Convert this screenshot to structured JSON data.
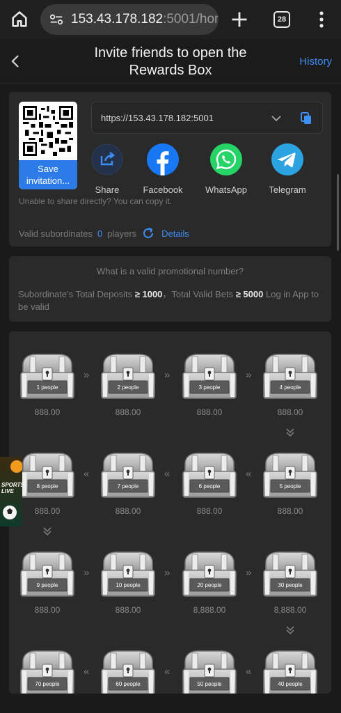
{
  "browser": {
    "url_host": "153.43.178.182",
    "url_rest": ":5001/hom",
    "tab_count": "28"
  },
  "header": {
    "title": "Invite friends to open the Rewards Box",
    "history_label": "History"
  },
  "share": {
    "qr_button_label": "Save invitation...",
    "link_text": "https://153.43.178.182:5001",
    "options": [
      {
        "label": "Share",
        "icon": "share-icon"
      },
      {
        "label": "Facebook",
        "icon": "facebook-icon"
      },
      {
        "label": "WhatsApp",
        "icon": "whatsapp-icon"
      },
      {
        "label": "Telegram",
        "icon": "telegram-icon"
      }
    ],
    "hint": "Unable to share directly? You can copy it.",
    "valid_prefix": "Valid subordinates",
    "valid_count": "0",
    "valid_suffix": "players",
    "details_label": "Details"
  },
  "info": {
    "question": "What is a valid promotional number?",
    "rule_prefix": "Subordinate's Total Deposits",
    "rule_deposit": "≥ 1000",
    "rule_mid": "，Total Valid Bets",
    "rule_bet": "≥ 5000",
    "rule_suffix": "Log in App to be valid"
  },
  "boxes": [
    {
      "label": "1 people",
      "amount": "888.00"
    },
    {
      "label": "2 people",
      "amount": "888.00"
    },
    {
      "label": "3 people",
      "amount": "888.00"
    },
    {
      "label": "4 people",
      "amount": "888.00"
    },
    {
      "label": "5 people",
      "amount": "888.00"
    },
    {
      "label": "6 people",
      "amount": "888.00"
    },
    {
      "label": "7 people",
      "amount": "888.00"
    },
    {
      "label": "8 people",
      "amount": "888.00"
    },
    {
      "label": "9 people",
      "amount": "888.00"
    },
    {
      "label": "10 people",
      "amount": "888.00"
    },
    {
      "label": "20 people",
      "amount": "8,888.00"
    },
    {
      "label": "30 people",
      "amount": "8,888.00"
    },
    {
      "label": "40 people",
      "amount": ""
    },
    {
      "label": "50 people",
      "amount": ""
    },
    {
      "label": "60 people",
      "amount": ""
    },
    {
      "label": "70 people",
      "amount": ""
    }
  ],
  "ad": {
    "text": "SPORTS LIVE"
  },
  "colors": {
    "accent": "#3e8ff7",
    "card": "#2a2a2a",
    "background": "#1a1a1a"
  }
}
